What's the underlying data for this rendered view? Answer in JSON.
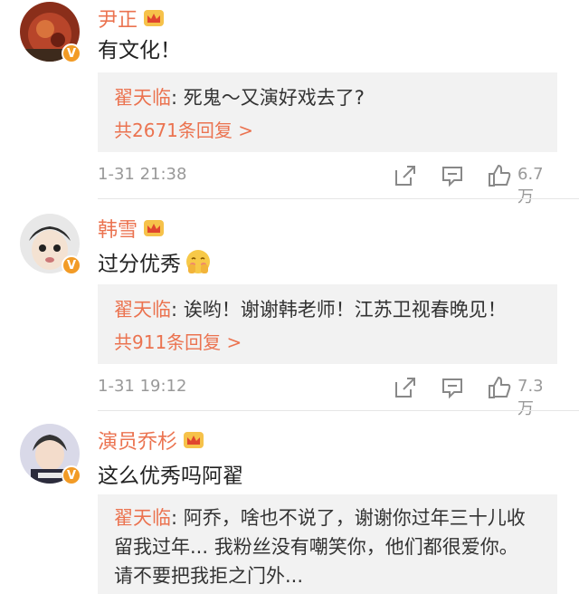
{
  "comments": [
    {
      "user": "尹正",
      "text": "有文化！",
      "reply_user": "翟天临",
      "reply_lines": [
        "死鬼～又演好戏去了?"
      ],
      "reply_count": "共2671条回复 >",
      "time": "1-31 21:38",
      "likes": "6.7万"
    },
    {
      "user": "韩雪",
      "text": "过分优秀",
      "reply_user": "翟天临",
      "reply_lines": [
        "诶哟！谢谢韩老师！江苏卫视春晚见！"
      ],
      "reply_count": "共911条回复 >",
      "time": "1-31 19:12",
      "likes": "7.3万"
    },
    {
      "user": "演员乔杉",
      "text": "这么优秀吗阿翟",
      "reply_user": "翟天临",
      "reply_lines": [
        "阿乔，啥也不说了，谢谢你过年三十儿收",
        "留我过年... 我粉丝没有嘲笑你，他们都很爱你。",
        "请不要把我拒之门外..."
      ]
    }
  ],
  "icons": {
    "verified": "V",
    "crown": "crown-icon",
    "share": "share-icon",
    "comment": "comment-icon",
    "like": "thumbs-up-icon",
    "emoji": "blush-emoji-icon"
  },
  "colors": {
    "username": "#eb7350",
    "reply_bg": "#f2f2f2",
    "meta_gray": "#999999",
    "badge": "#f29b26"
  }
}
